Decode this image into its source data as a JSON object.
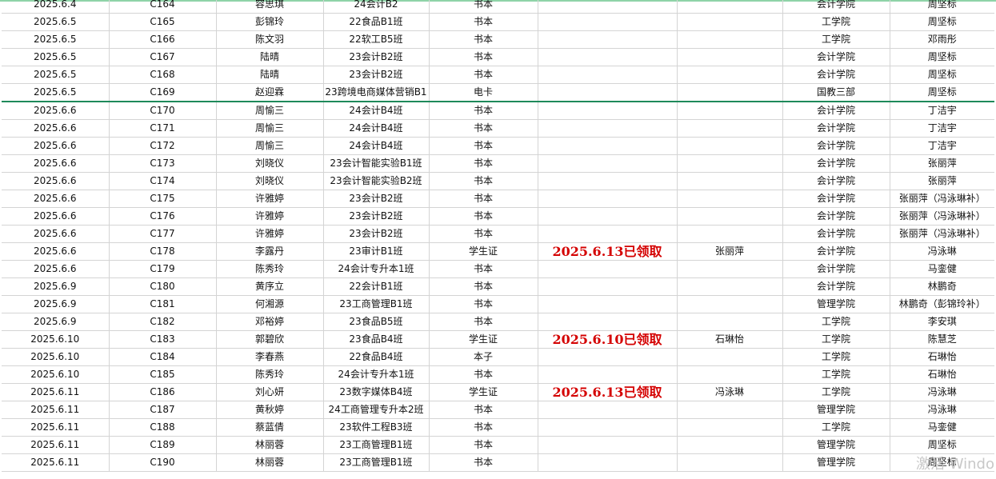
{
  "rows": [
    [
      "2025.6.4",
      "C164",
      "容思琪",
      "24会计B2",
      "书本",
      "",
      "",
      "会计学院",
      "周坚标"
    ],
    [
      "2025.6.5",
      "C165",
      "彭锦玲",
      "22食品B1班",
      "书本",
      "",
      "",
      "工学院",
      "周坚标"
    ],
    [
      "2025.6.5",
      "C166",
      "陈文羽",
      "22软工B5班",
      "书本",
      "",
      "",
      "工学院",
      "邓雨彤"
    ],
    [
      "2025.6.5",
      "C167",
      "陆晴",
      "23会计B2班",
      "书本",
      "",
      "",
      "会计学院",
      "周坚标"
    ],
    [
      "2025.6.5",
      "C168",
      "陆晴",
      "23会计B2班",
      "书本",
      "",
      "",
      "会计学院",
      "周坚标"
    ],
    [
      "2025.6.5",
      "C169",
      "赵迎霖",
      "23跨境电商媒体营销B1",
      "电卡",
      "",
      "",
      "国教三部",
      "周坚标"
    ],
    [
      "2025.6.6",
      "C170",
      "周愉三",
      "24会计B4班",
      "书本",
      "",
      "",
      "会计学院",
      "丁洁宇"
    ],
    [
      "2025.6.6",
      "C171",
      "周愉三",
      "24会计B4班",
      "书本",
      "",
      "",
      "会计学院",
      "丁洁宇"
    ],
    [
      "2025.6.6",
      "C172",
      "周愉三",
      "24会计B4班",
      "书本",
      "",
      "",
      "会计学院",
      "丁洁宇"
    ],
    [
      "2025.6.6",
      "C173",
      "刘晓仪",
      "23会计智能实验B1班",
      "书本",
      "",
      "",
      "会计学院",
      "张丽萍"
    ],
    [
      "2025.6.6",
      "C174",
      "刘晓仪",
      "23会计智能实验B2班",
      "书本",
      "",
      "",
      "会计学院",
      "张丽萍"
    ],
    [
      "2025.6.6",
      "C175",
      "许雅婷",
      "23会计B2班",
      "书本",
      "",
      "",
      "会计学院",
      "张丽萍（冯泳琳补）"
    ],
    [
      "2025.6.6",
      "C176",
      "许雅婷",
      "23会计B2班",
      "书本",
      "",
      "",
      "会计学院",
      "张丽萍（冯泳琳补）"
    ],
    [
      "2025.6.6",
      "C177",
      "许雅婷",
      "23会计B2班",
      "书本",
      "",
      "",
      "会计学院",
      "张丽萍（冯泳琳补）"
    ],
    [
      "2025.6.6",
      "C178",
      "李露丹",
      "23审计B1班",
      "学生证",
      "2025.6.13已领取",
      "张丽萍",
      "会计学院",
      "冯泳琳"
    ],
    [
      "2025.6.6",
      "C179",
      "陈秀玲",
      "24会计专升本1班",
      "书本",
      "",
      "",
      "会计学院",
      "马銮健"
    ],
    [
      "2025.6.9",
      "C180",
      "黄序立",
      "22会计B1班",
      "书本",
      "",
      "",
      "会计学院",
      "林鹏奇"
    ],
    [
      "2025.6.9",
      "C181",
      "何湘源",
      "23工商管理B1班",
      "书本",
      "",
      "",
      "管理学院",
      "林鹏奇（彭锦玲补）"
    ],
    [
      "2025.6.9",
      "C182",
      "邓裕婷",
      "23食品B5班",
      "书本",
      "",
      "",
      "工学院",
      "李安琪"
    ],
    [
      "2025.6.10",
      "C183",
      "郭碧欣",
      "23食品B4班",
      "学生证",
      "2025.6.10已领取",
      "石琳怡",
      "工学院",
      "陈慧芝"
    ],
    [
      "2025.6.10",
      "C184",
      "李春燕",
      "22食品B4班",
      "本子",
      "",
      "",
      "工学院",
      "石琳怡"
    ],
    [
      "2025.6.10",
      "C185",
      "陈秀玲",
      "24会计专升本1班",
      "书本",
      "",
      "",
      "工学院",
      "石琳怡"
    ],
    [
      "2025.6.11",
      "C186",
      "刘心妍",
      "23数字媒体B4班",
      "学生证",
      "2025.6.13已领取",
      "冯泳琳",
      "工学院",
      "冯泳琳"
    ],
    [
      "2025.6.11",
      "C187",
      "黄秋婷",
      "24工商管理专升本2班",
      "书本",
      "",
      "",
      "管理学院",
      "冯泳琳"
    ],
    [
      "2025.6.11",
      "C188",
      "蔡蓝倩",
      "23软件工程B3班",
      "书本",
      "",
      "",
      "工学院",
      "马銮健"
    ],
    [
      "2025.6.11",
      "C189",
      "林丽蓉",
      "23工商管理B1班",
      "书本",
      "",
      "",
      "管理学院",
      "周坚标"
    ],
    [
      "2025.6.11",
      "C190",
      "林丽蓉",
      "23工商管理B1班",
      "书本",
      "",
      "",
      "管理学院",
      "周坚标"
    ]
  ],
  "watermark": "激活 Windo"
}
